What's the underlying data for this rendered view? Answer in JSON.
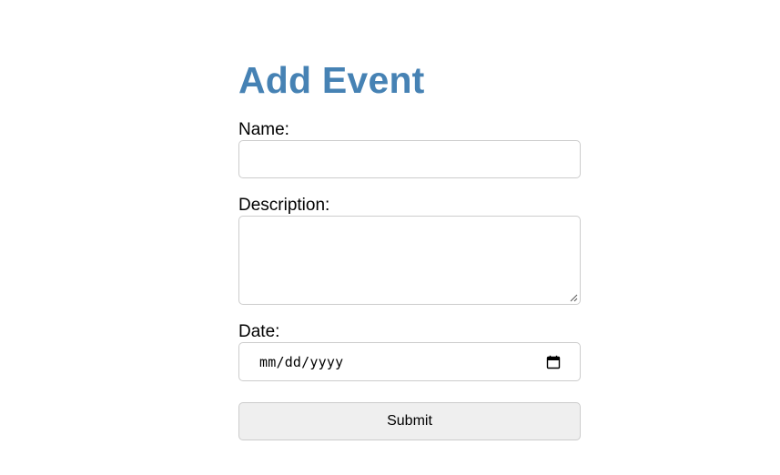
{
  "page": {
    "title": "Add Event"
  },
  "form": {
    "name": {
      "label": "Name:",
      "value": ""
    },
    "description": {
      "label": "Description:",
      "value": ""
    },
    "date": {
      "label": "Date:",
      "placeholder": "mm/dd/yyyy",
      "icon": "calendar-icon"
    },
    "submit_label": "Submit"
  },
  "colors": {
    "title": "#4682b4",
    "border": "#cccccc",
    "button_bg": "#efefef"
  }
}
